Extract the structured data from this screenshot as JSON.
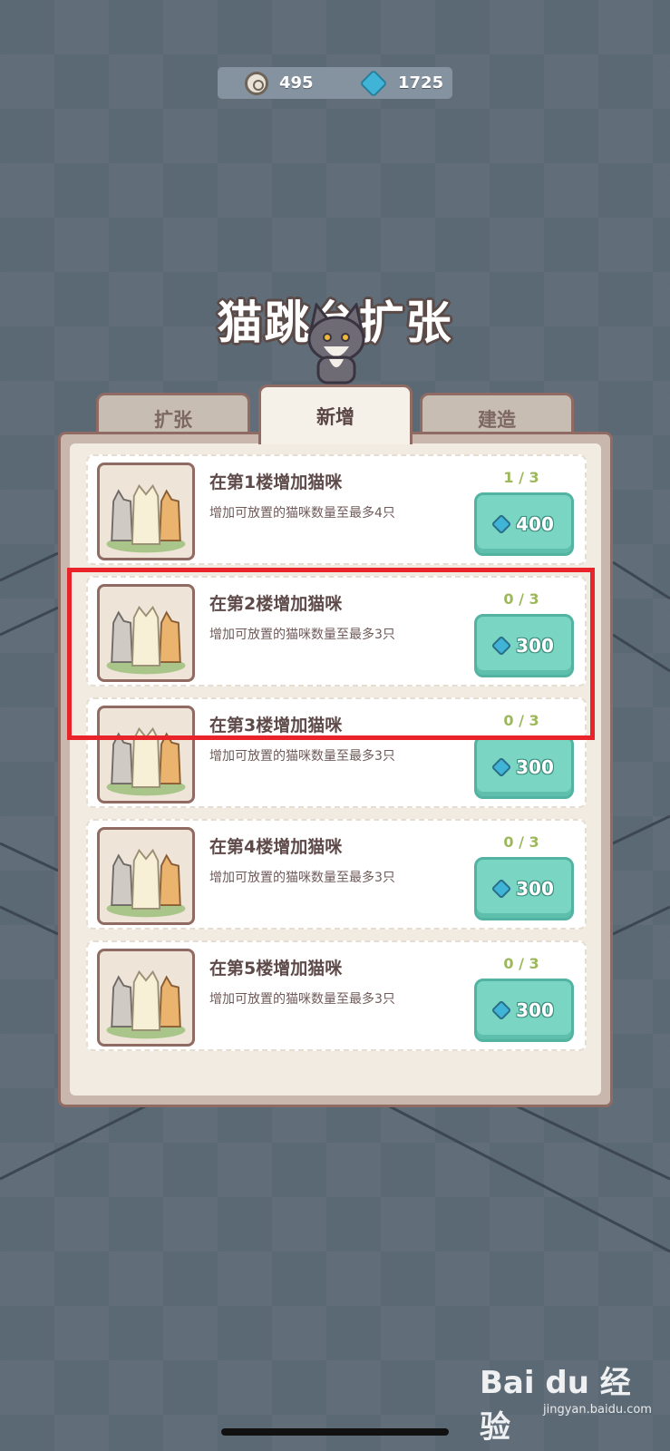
{
  "currency": {
    "coins": "495",
    "gems": "1725"
  },
  "title": "猫跳台扩张",
  "tabs": [
    {
      "label": "扩张"
    },
    {
      "label": "新增"
    },
    {
      "label": "建造"
    }
  ],
  "active_tab": "新增",
  "items": [
    {
      "title": "在第1楼增加猫咪",
      "desc": "增加可放置的猫咪数量至最多4只",
      "progress": "1 / 3",
      "price": "400"
    },
    {
      "title": "在第2楼增加猫咪",
      "desc": "增加可放置的猫咪数量至最多3只",
      "progress": "0 / 3",
      "price": "300"
    },
    {
      "title": "在第3楼增加猫咪",
      "desc": "增加可放置的猫咪数量至最多3只",
      "progress": "0 / 3",
      "price": "300"
    },
    {
      "title": "在第4楼增加猫咪",
      "desc": "增加可放置的猫咪数量至最多3只",
      "progress": "0 / 3",
      "price": "300"
    },
    {
      "title": "在第5楼增加猫咪",
      "desc": "增加可放置的猫咪数量至最多3只",
      "progress": "0 / 3",
      "price": "300"
    }
  ],
  "icons": {
    "coin": "coin-icon",
    "gem": "gem-icon",
    "thumbnail": "three-cats-icon"
  },
  "colors": {
    "background": "#5b6975",
    "panel_border": "#8f6b63",
    "button": "#7ad6c3",
    "progress_text": "#9cb85a",
    "highlight": "#e8242a"
  },
  "watermark": {
    "brand": "Bai du 经验",
    "sub": "jingyan.baidu.com"
  }
}
